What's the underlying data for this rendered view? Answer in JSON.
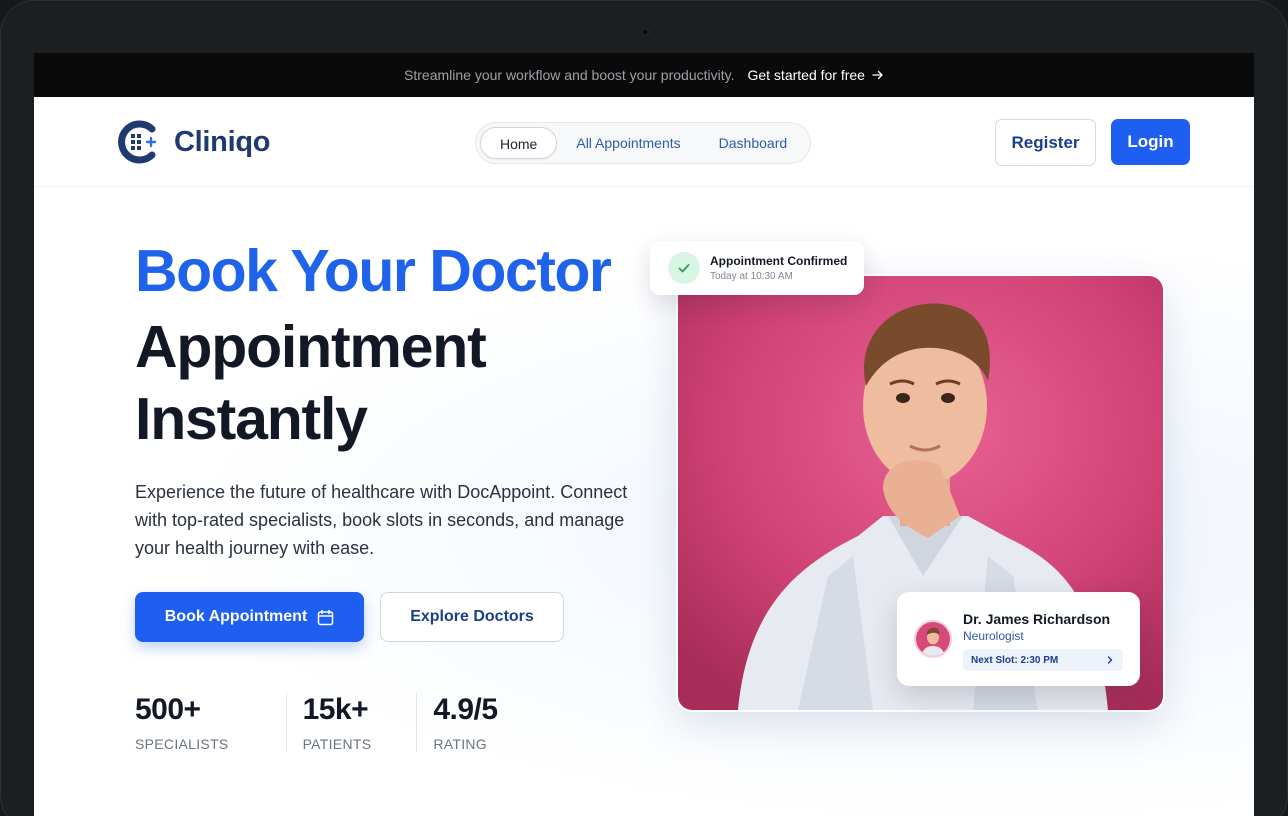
{
  "announcement": {
    "message": "Streamline your workflow and boost your productivity.",
    "cta_label": "Get started for free",
    "cta_icon": "arrow-right-icon"
  },
  "brand": {
    "name": "Cliniqo",
    "logo_icon": "clinic-logo-icon",
    "color": "#1e3a6e"
  },
  "nav": {
    "items": [
      {
        "label": "Home",
        "active": true
      },
      {
        "label": "All Appointments",
        "active": false
      },
      {
        "label": "Dashboard",
        "active": false
      }
    ],
    "register_label": "Register",
    "login_label": "Login"
  },
  "hero": {
    "title_highlight": "Book Your Doctor",
    "title_line2": "Appointment",
    "title_line3": "Instantly",
    "description": "Experience the future of healthcare with DocAppoint. Connect with top-rated specialists, book slots in seconds, and manage your health journey with ease.",
    "primary_cta": "Book Appointment",
    "primary_cta_icon": "calendar-icon",
    "secondary_cta": "Explore Doctors",
    "stats": [
      {
        "value": "500+",
        "label": "SPECIALISTS"
      },
      {
        "value": "15k+",
        "label": "PATIENTS"
      },
      {
        "value": "4.9/5",
        "label": "RATING"
      }
    ]
  },
  "toast": {
    "title": "Appointment Confirmed",
    "subtitle": "Today at 10:30 AM",
    "icon": "check-icon"
  },
  "doctor_card": {
    "name": "Dr. James Richardson",
    "specialty": "Neurologist",
    "next_slot": "Next Slot: 2:30 PM",
    "slot_icon": "chevron-right-icon"
  },
  "colors": {
    "accent": "#1e5ef0",
    "heading_blue": "#1e63e9",
    "photo_background": "#d9487a",
    "success": "#2f9e5b"
  }
}
